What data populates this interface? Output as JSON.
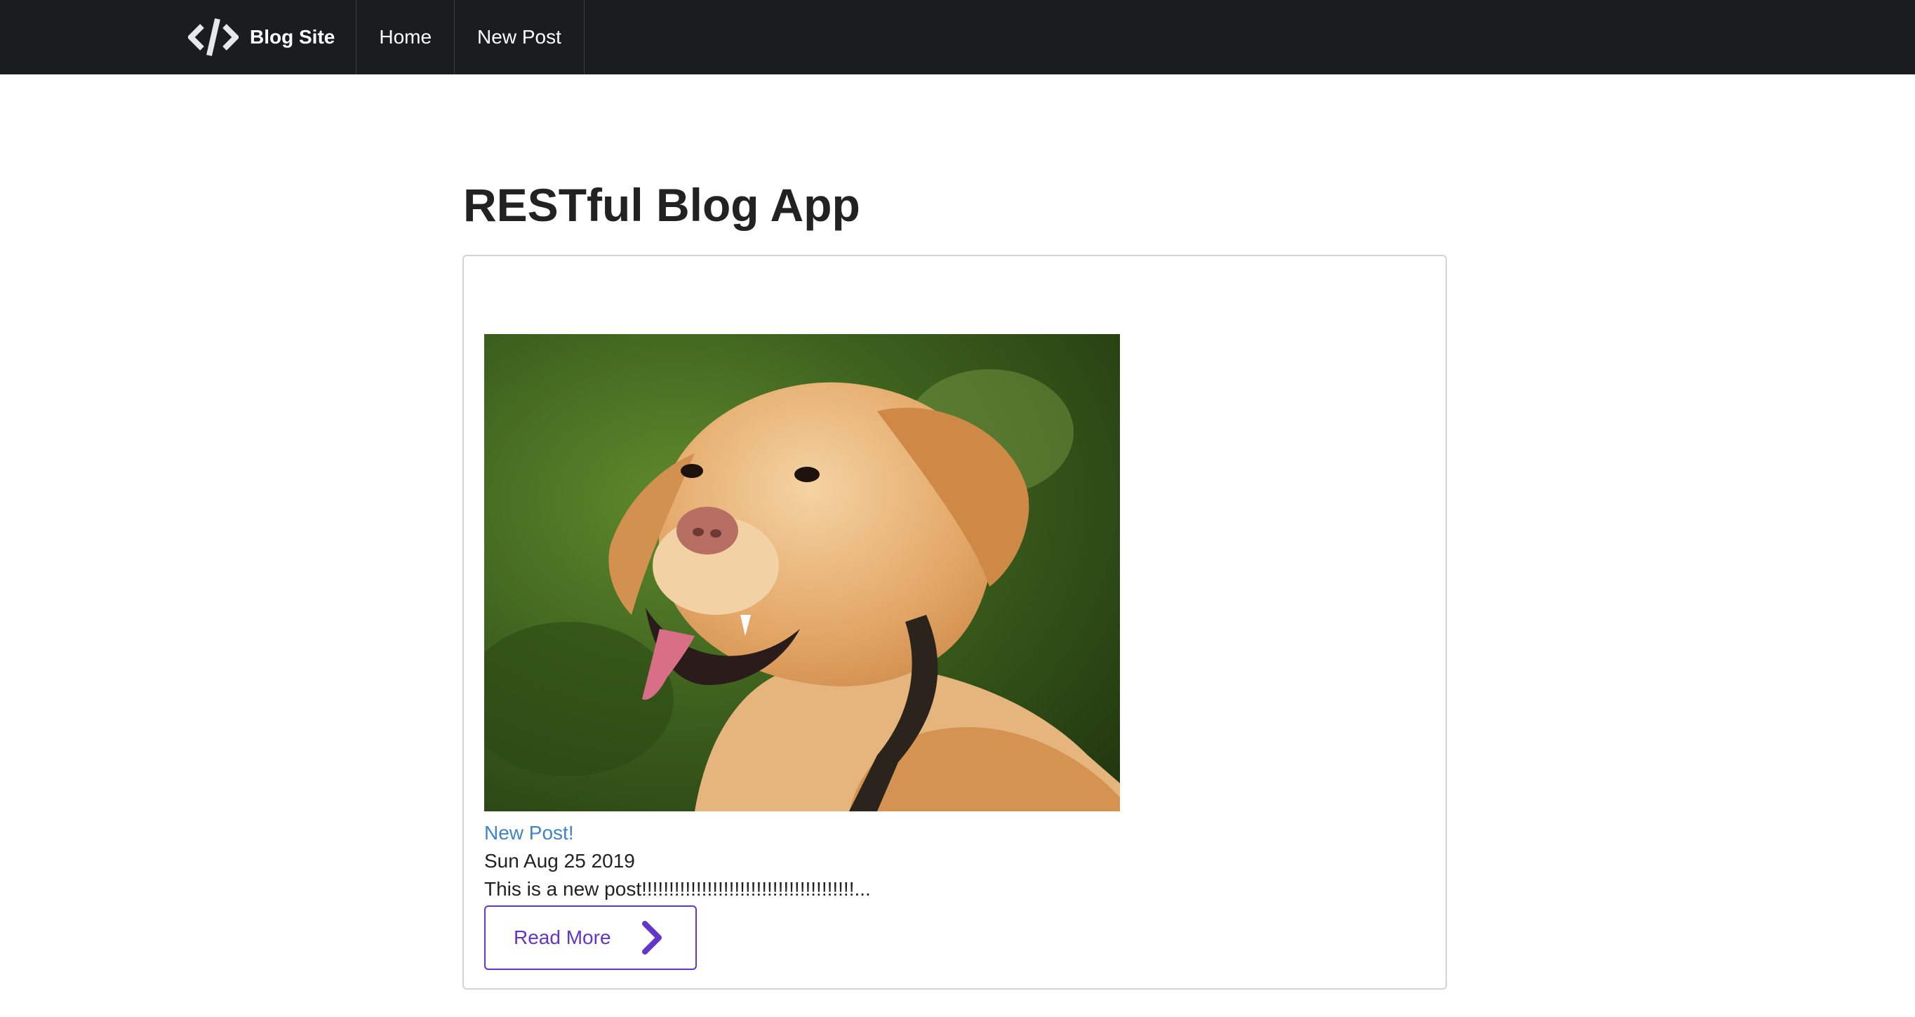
{
  "navbar": {
    "brand_label": "Blog Site",
    "brand_icon": "code-icon",
    "items": [
      {
        "label": "Home"
      },
      {
        "label": "New Post"
      }
    ]
  },
  "main": {
    "title": "RESTful Blog App",
    "posts": [
      {
        "image": "dog-photo",
        "title": "New Post!",
        "date": "Sun Aug 25 2019",
        "body": "This is a new post!!!!!!!!!!!!!!!!!!!!!!!!!!!!!!!!!!!!!!!...",
        "read_more_label": "Read More",
        "read_more_icon": "chevron-right-icon"
      }
    ]
  },
  "colors": {
    "navbar_bg": "#1b1c1d",
    "link": "#4183c4",
    "accent_violet": "#6435c9",
    "border": "#d4d4d5"
  }
}
